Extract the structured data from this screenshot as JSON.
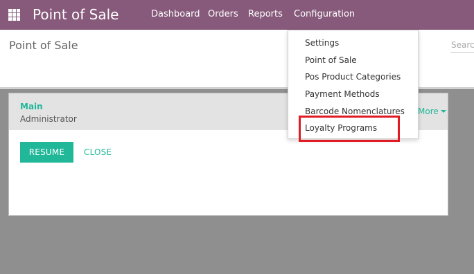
{
  "app": {
    "brand": "Point of Sale"
  },
  "navbar": {
    "menu": [
      "Dashboard",
      "Orders",
      "Reports",
      "Configuration"
    ]
  },
  "control_panel": {
    "title": "Point of Sale",
    "search_placeholder": "Search..."
  },
  "pos_card": {
    "title": "Main",
    "user": "Administrator",
    "more_label": "More",
    "resume_label": "RESUME",
    "close_label": "CLOSE"
  },
  "config_dropdown": {
    "items": [
      "Settings",
      "Point of Sale",
      "Pos Product Categories",
      "Payment Methods",
      "Barcode Nomenclatures",
      "Loyalty Programs"
    ]
  },
  "colors": {
    "navbar": "#875a7b",
    "accent": "#21b799",
    "highlight": "#e01b24",
    "background_overlay": "#8f8f8f"
  }
}
